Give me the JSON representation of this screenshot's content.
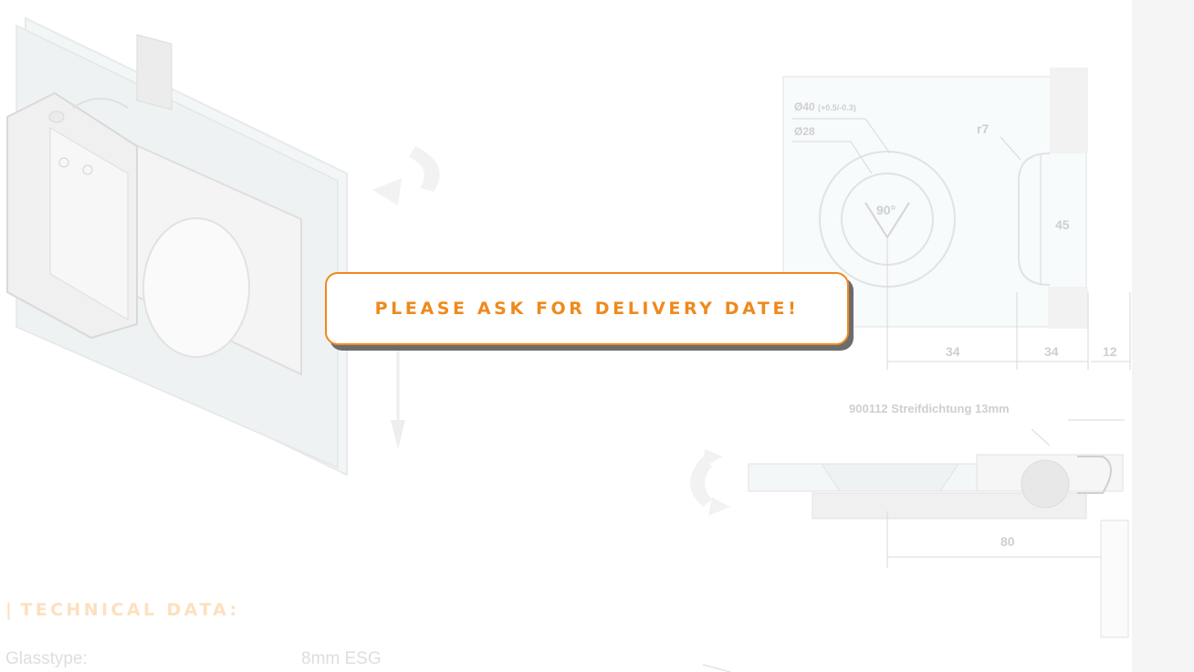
{
  "notice": {
    "label": "PLEASE ASK FOR DELIVERY DATE!",
    "accent_color": "#ee8a1c"
  },
  "drawing": {
    "diameter_outer_label": "Ø40",
    "diameter_outer_tolerance": "(+0.5/-0.3)",
    "diameter_inner_label": "Ø28",
    "radius_label": "r7",
    "angle_label": "90°",
    "height_label": "45",
    "width_a_label": "34",
    "width_b_label": "34",
    "width_c_label": "12",
    "seal_label": "900112 Streifdichtung 13mm",
    "depth_label": "80"
  },
  "technical_data": {
    "heading": "TECHNICAL DATA:",
    "rows": [
      {
        "label": "Glasstype:",
        "value": "8mm ESG"
      }
    ]
  },
  "icons": [
    "rotate-arrow-icon",
    "rotate-arrow-icon",
    "down-arrow-icon",
    "product-hinge-illustration"
  ]
}
